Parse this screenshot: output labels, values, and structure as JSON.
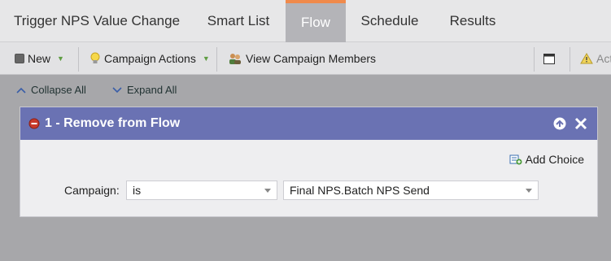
{
  "tabs": [
    {
      "label": "Trigger NPS Value Change"
    },
    {
      "label": "Smart List"
    },
    {
      "label": "Flow"
    },
    {
      "label": "Schedule"
    },
    {
      "label": "Results"
    }
  ],
  "active_tab": "Flow",
  "toolbar": {
    "new_label": "New",
    "campaign_actions_label": "Campaign Actions",
    "view_members_label": "View Campaign Members",
    "actions_partial_label": "Act"
  },
  "flow_controls": {
    "collapse_all": "Collapse All",
    "expand_all": "Expand All"
  },
  "step": {
    "title": "1 - Remove from Flow",
    "add_choice": "Add Choice",
    "field_label": "Campaign:",
    "operator_value": "is",
    "campaign_value": "Final NPS.Batch NPS Send"
  },
  "colors": {
    "accent_tab": "#f08a4b",
    "panel_header": "#6a72b3",
    "caret_green": "#5f9d42"
  }
}
